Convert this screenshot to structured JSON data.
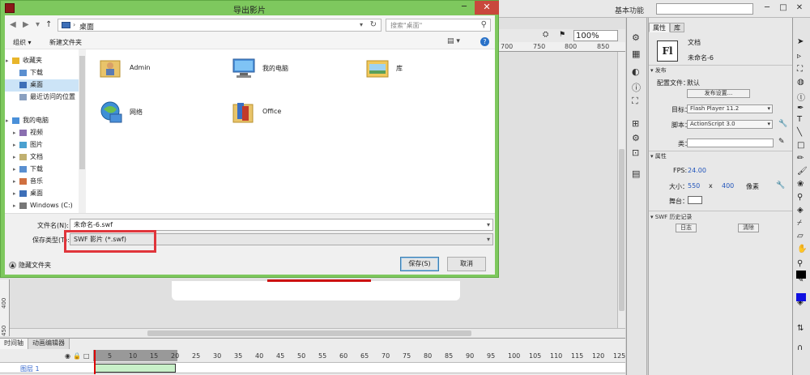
{
  "app": {
    "workspace": "基本功能",
    "zoom": "100%",
    "ruler_top": [
      "700",
      "750",
      "800",
      "850"
    ],
    "ruler_left": [
      "400",
      "450"
    ],
    "timeline_tabs": [
      "时间轴",
      "动画编辑器"
    ],
    "frame_numbers": [
      "5",
      "10",
      "15",
      "20",
      "25",
      "30",
      "35",
      "40",
      "45",
      "50",
      "55",
      "60",
      "65",
      "70",
      "75",
      "80",
      "85",
      "90",
      "95",
      "100",
      "105",
      "110",
      "115",
      "120",
      "125"
    ],
    "layer_name": "图层 1"
  },
  "props": {
    "tabs": [
      "属性",
      "库"
    ],
    "doc_icon": "Fl",
    "doc_type": "文档",
    "doc_name": "未命名-6",
    "publish_section": "发布",
    "profile_label": "配置文件：",
    "profile_value": "默认",
    "publish_settings_btn": "发布设置...",
    "target_label": "目标：",
    "target_value": "Flash Player 11.2",
    "script_label": "脚本：",
    "script_value": "ActionScript 3.0",
    "class_label": "类：",
    "props_section": "属性",
    "fps_label": "FPS:",
    "fps_value": "24.00",
    "size_label": "大小：",
    "width": "550",
    "x": "x",
    "height": "400",
    "unit": "像素",
    "stage_label": "舞台：",
    "history_section": "SWF 历史记录",
    "log_btn": "日志",
    "clear_btn": "清除"
  },
  "dialog": {
    "title": "导出影片",
    "address": "桌面",
    "search_placeholder": "搜索\"桌面\"",
    "organize": "组织 ▾",
    "new_folder": "新建文件夹",
    "tree": [
      {
        "label": "收藏夹",
        "caret": "▸"
      },
      {
        "label": "下载",
        "caret": ""
      },
      {
        "label": "桌面",
        "caret": ""
      },
      {
        "label": "最近访问的位置",
        "caret": ""
      },
      {
        "label": "我的电脑",
        "caret": "▸"
      },
      {
        "label": "视频",
        "caret": "▸"
      },
      {
        "label": "图片",
        "caret": "▸"
      },
      {
        "label": "文档",
        "caret": "▸"
      },
      {
        "label": "下载",
        "caret": "▸"
      },
      {
        "label": "音乐",
        "caret": "▸"
      },
      {
        "label": "桌面",
        "caret": "▸"
      },
      {
        "label": "Windows (C:)",
        "caret": "▸"
      }
    ],
    "files": [
      {
        "label": "Admin",
        "icon": "user-folder-icon"
      },
      {
        "label": "我的电脑",
        "icon": "computer-icon"
      },
      {
        "label": "库",
        "icon": "library-icon"
      },
      {
        "label": "网络",
        "icon": "network-icon"
      },
      {
        "label": "Office",
        "icon": "folder-icon"
      }
    ],
    "filename_label": "文件名(N):",
    "filename_value": "未命名-6.swf",
    "filetype_label": "保存类型(T):",
    "filetype_value": "SWF 影片 (*.swf)",
    "hide_folders": "隐藏文件夹",
    "save_btn": "保存(S)",
    "cancel_btn": "取消"
  },
  "colors": {
    "dialog_frame": "#7ec85e",
    "close_button": "#c9483c",
    "highlight": "#e0353b",
    "selected": "#cce4f7"
  }
}
